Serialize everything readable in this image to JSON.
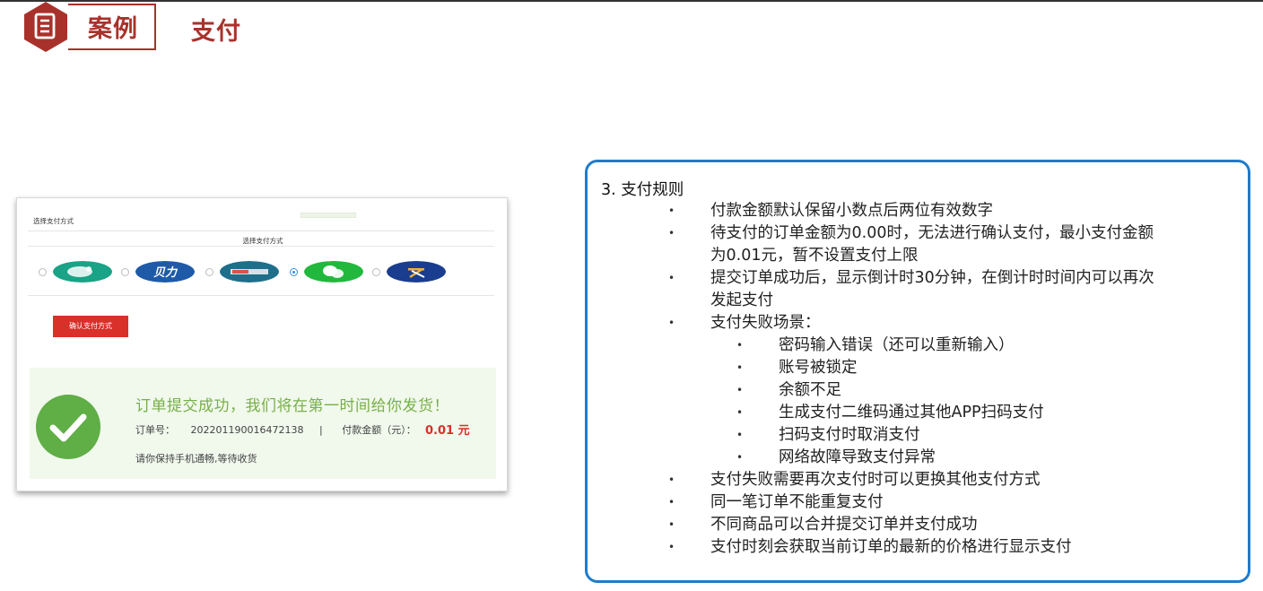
{
  "header": {
    "badge": "案例",
    "title": "支付",
    "colors": {
      "accent": "#a8322b"
    },
    "icon": "document-icon"
  },
  "screenshot": {
    "heading": "选择支付方式",
    "subheading": "选择支付方式",
    "payment_methods": [
      {
        "icon": "payment-logo-green-icon",
        "selected": false,
        "color": "#1aa386"
      },
      {
        "icon": "payment-logo-beili-icon",
        "text": "贝力",
        "selected": false,
        "color": "#1e5aa8"
      },
      {
        "icon": "payment-logo-bank-icon",
        "selected": false,
        "color": "#1f6f8b"
      },
      {
        "icon": "payment-logo-wechat-icon",
        "selected": true,
        "color": "#22b83d"
      },
      {
        "icon": "payment-logo-alipay-icon",
        "selected": false,
        "color": "#1a3d8f"
      }
    ],
    "confirm_button": "确认支付方式",
    "success": {
      "title": "订单提交成功，我们将在第一时间给你发货！",
      "order_label": "订单号：",
      "order_number": "202201190016472138",
      "separator": "|",
      "amount_label": "付款金额（元）：",
      "amount": "0.01 元",
      "note": "请你保持手机通畅,等待收货"
    }
  },
  "rules": {
    "title": "3. 支付规则",
    "items": [
      {
        "level": 1,
        "text": "付款金额默认保留小数点后两位有效数字"
      },
      {
        "level": 1,
        "text": "待支付的订单金额为0.00时，无法进行确认支付，最小支付金额",
        "cont": "为0.01元，暂不设置支付上限"
      },
      {
        "level": 1,
        "text": "提交订单成功后，显示倒计时30分钟，在倒计时时间内可以再次",
        "cont": "发起支付"
      },
      {
        "level": 1,
        "text": "支付失败场景："
      },
      {
        "level": 2,
        "text": "密码输入错误（还可以重新输入）"
      },
      {
        "level": 2,
        "text": "账号被锁定"
      },
      {
        "level": 2,
        "text": "余额不足"
      },
      {
        "level": 2,
        "text": "生成支付二维码通过其他APP扫码支付"
      },
      {
        "level": 2,
        "text": "扫码支付时取消支付"
      },
      {
        "level": 2,
        "text": "网络故障导致支付异常"
      },
      {
        "level": 1,
        "text": "支付失败需要再次支付时可以更换其他支付方式"
      },
      {
        "level": 1,
        "text": "同一笔订单不能重复支付"
      },
      {
        "level": 1,
        "text": "不同商品可以合并提交订单并支付成功"
      },
      {
        "level": 1,
        "text": "支付时刻会获取当前订单的最新的价格进行显示支付"
      }
    ],
    "bullet": "•",
    "colors": {
      "border": "#1f7ccc"
    }
  }
}
